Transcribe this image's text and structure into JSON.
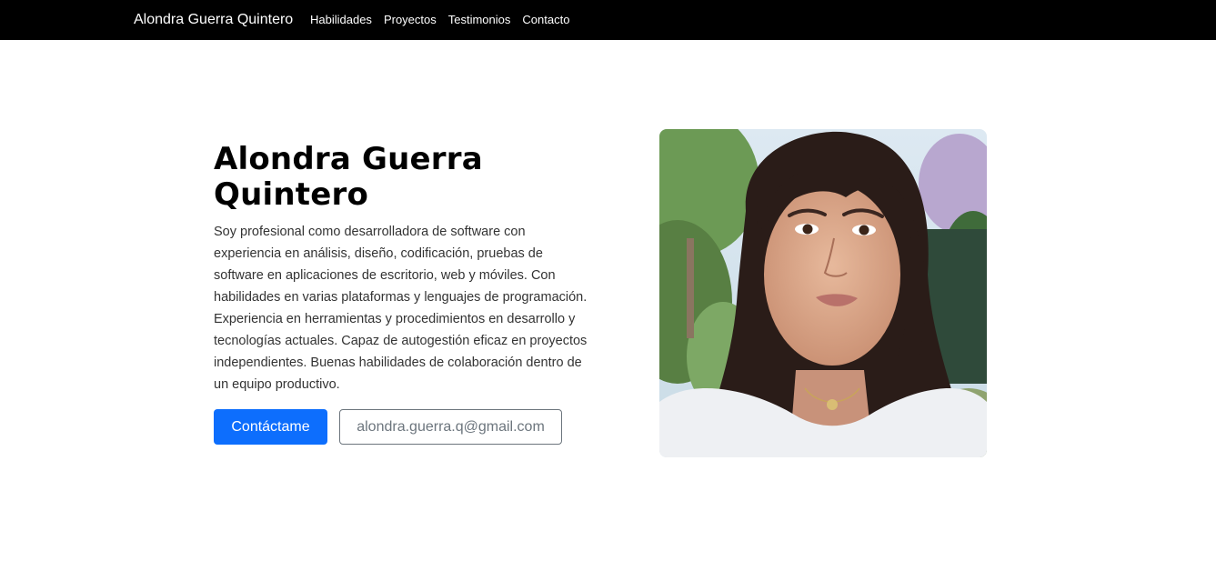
{
  "navbar": {
    "brand": "Alondra Guerra Quintero",
    "links": [
      "Habilidades",
      "Proyectos",
      "Testimonios",
      "Contacto"
    ]
  },
  "hero": {
    "title": "Alondra Guerra Quintero",
    "description": "Soy profesional como desarrolladora de software con experiencia en análisis, diseño, codificación, pruebas de software en aplicaciones de escritorio, web y móviles. Con habilidades en varias plataformas y lenguajes de programación. Experiencia en herramientas y procedimientos en desarrollo y tecnologías actuales. Capaz de autogestión eficaz en proyectos independientes. Buenas habilidades de colaboración dentro de un equipo productivo.",
    "contact_button": "Contáctame",
    "email_button": "alondra.guerra.q@gmail.com"
  },
  "colors": {
    "navbar_bg": "#000000",
    "primary": "#0d6efd",
    "outline": "#6c757d"
  }
}
